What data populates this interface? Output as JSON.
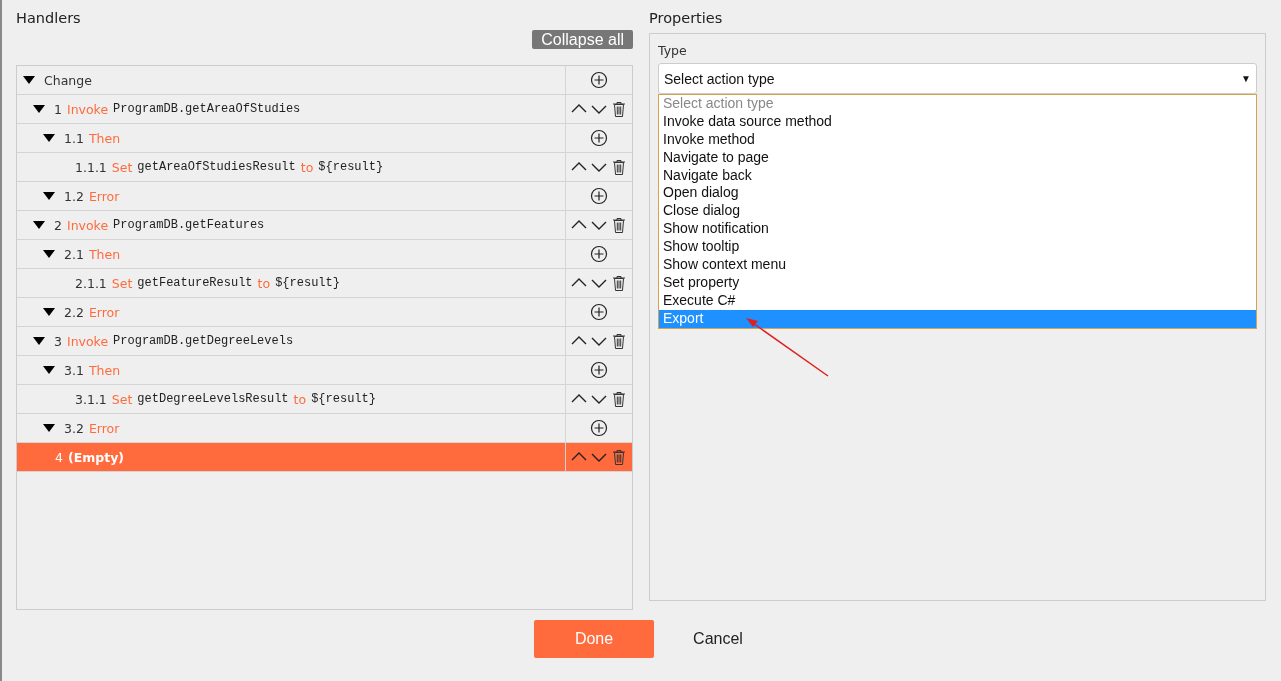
{
  "handlers": {
    "title": "Handlers",
    "collapse_button": "Collapse all",
    "tree": [
      {
        "label": "Change",
        "expanded": true,
        "kind": "add",
        "selected": false,
        "children": [
          {
            "number": "1",
            "parts": [
              {
                "kind": "keyword",
                "text": "Invoke"
              },
              {
                "kind": "code",
                "text": "ProgramDB.getAreaOfStudies"
              }
            ],
            "expanded": true,
            "kind": "move",
            "selected": false,
            "children": [
              {
                "number": "1.1",
                "parts": [
                  {
                    "kind": "keyword",
                    "text": "Then"
                  }
                ],
                "expanded": true,
                "kind": "add",
                "selected": false,
                "children": [
                  {
                    "number": "1.1.1",
                    "parts": [
                      {
                        "kind": "keyword",
                        "text": "Set"
                      },
                      {
                        "kind": "code",
                        "text": "getAreaOfStudiesResult"
                      },
                      {
                        "kind": "keyword",
                        "text": "to"
                      },
                      {
                        "kind": "code",
                        "text": "${result}"
                      }
                    ],
                    "kind": "move",
                    "selected": false
                  }
                ]
              },
              {
                "number": "1.2",
                "parts": [
                  {
                    "kind": "keyword",
                    "text": "Error"
                  }
                ],
                "expanded": true,
                "kind": "add",
                "selected": false
              }
            ]
          },
          {
            "number": "2",
            "parts": [
              {
                "kind": "keyword",
                "text": "Invoke"
              },
              {
                "kind": "code",
                "text": "ProgramDB.getFeatures"
              }
            ],
            "expanded": true,
            "kind": "move",
            "selected": false,
            "children": [
              {
                "number": "2.1",
                "parts": [
                  {
                    "kind": "keyword",
                    "text": "Then"
                  }
                ],
                "expanded": true,
                "kind": "add",
                "selected": false,
                "children": [
                  {
                    "number": "2.1.1",
                    "parts": [
                      {
                        "kind": "keyword",
                        "text": "Set"
                      },
                      {
                        "kind": "code",
                        "text": "getFeatureResult"
                      },
                      {
                        "kind": "keyword",
                        "text": "to"
                      },
                      {
                        "kind": "code",
                        "text": "${result}"
                      }
                    ],
                    "kind": "move",
                    "selected": false
                  }
                ]
              },
              {
                "number": "2.2",
                "parts": [
                  {
                    "kind": "keyword",
                    "text": "Error"
                  }
                ],
                "expanded": true,
                "kind": "add",
                "selected": false
              }
            ]
          },
          {
            "number": "3",
            "parts": [
              {
                "kind": "keyword",
                "text": "Invoke"
              },
              {
                "kind": "code",
                "text": "ProgramDB.getDegreeLevels"
              }
            ],
            "expanded": true,
            "kind": "move",
            "selected": false,
            "children": [
              {
                "number": "3.1",
                "parts": [
                  {
                    "kind": "keyword",
                    "text": "Then"
                  }
                ],
                "expanded": true,
                "kind": "add",
                "selected": false,
                "children": [
                  {
                    "number": "3.1.1",
                    "parts": [
                      {
                        "kind": "keyword",
                        "text": "Set"
                      },
                      {
                        "kind": "code",
                        "text": "getDegreeLevelsResult"
                      },
                      {
                        "kind": "keyword",
                        "text": "to"
                      },
                      {
                        "kind": "code",
                        "text": "${result}"
                      }
                    ],
                    "kind": "move",
                    "selected": false
                  }
                ]
              },
              {
                "number": "3.2",
                "parts": [
                  {
                    "kind": "keyword",
                    "text": "Error"
                  }
                ],
                "expanded": true,
                "kind": "add",
                "selected": false
              }
            ]
          },
          {
            "number": "4",
            "parts": [
              {
                "kind": "empty",
                "text": "(Empty)"
              }
            ],
            "kind": "move",
            "selected": true
          }
        ]
      }
    ]
  },
  "properties": {
    "title": "Properties",
    "type_label": "Type",
    "type_select": {
      "value": "Select action type",
      "arrow": "▼",
      "expanded": true
    },
    "options": [
      {
        "text": "Select action type",
        "disabled": true,
        "selected": false
      },
      {
        "text": "Invoke data source method",
        "disabled": false,
        "selected": false
      },
      {
        "text": "Invoke method",
        "disabled": false,
        "selected": false
      },
      {
        "text": "Navigate to page",
        "disabled": false,
        "selected": false
      },
      {
        "text": "Navigate back",
        "disabled": false,
        "selected": false
      },
      {
        "text": "Open dialog",
        "disabled": false,
        "selected": false
      },
      {
        "text": "Close dialog",
        "disabled": false,
        "selected": false
      },
      {
        "text": "Show notification",
        "disabled": false,
        "selected": false
      },
      {
        "text": "Show tooltip",
        "disabled": false,
        "selected": false
      },
      {
        "text": "Show context menu",
        "disabled": false,
        "selected": false
      },
      {
        "text": "Set property",
        "disabled": false,
        "selected": false
      },
      {
        "text": "Execute C#",
        "disabled": false,
        "selected": false
      },
      {
        "text": "Export",
        "disabled": false,
        "selected": true
      }
    ]
  },
  "footer": {
    "done_button": "Done",
    "cancel_button": "Cancel"
  }
}
